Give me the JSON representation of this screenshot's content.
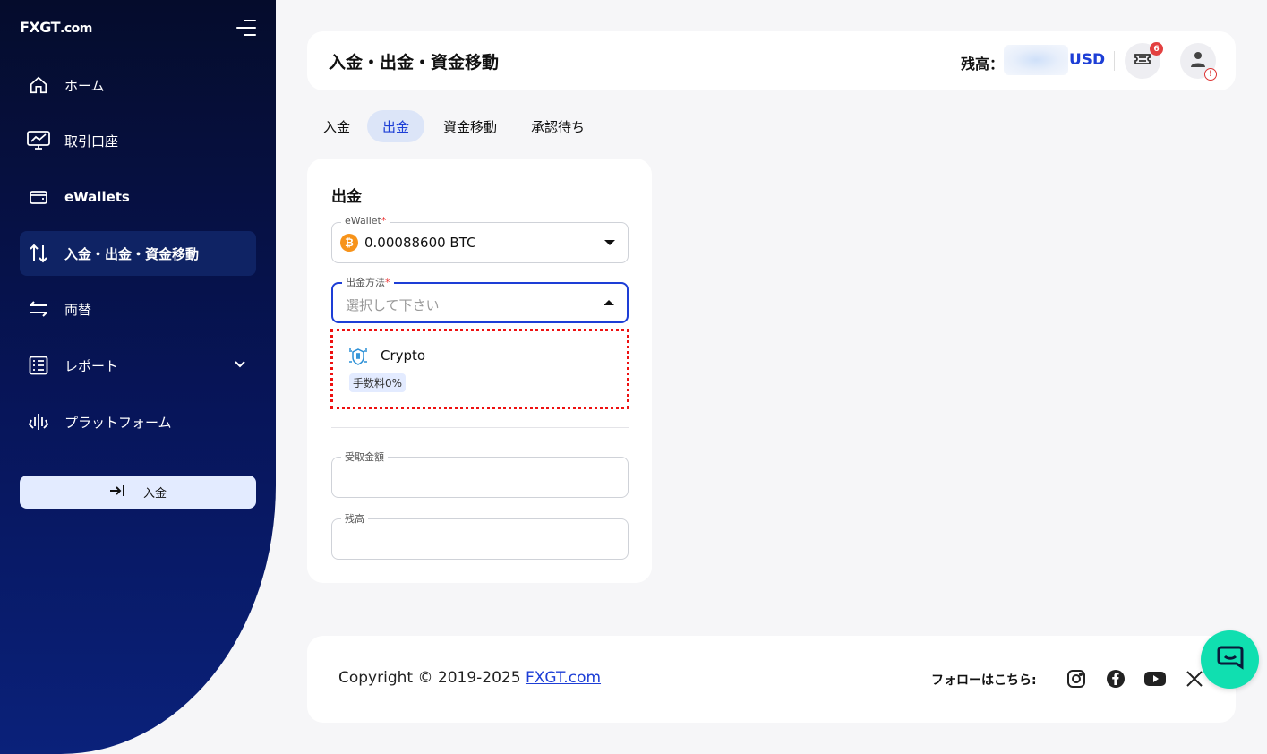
{
  "sidebar": {
    "logo_fx": "FX",
    "logo_gt": "GT",
    "logo_domain": ".com",
    "items": [
      {
        "label": "ホーム"
      },
      {
        "label": "取引口座"
      },
      {
        "label": "eWallets"
      },
      {
        "label": "入金・出金・資金移動"
      },
      {
        "label": "両替"
      },
      {
        "label": "レポート"
      },
      {
        "label": "プラットフォーム"
      }
    ],
    "deposit_button": "入金"
  },
  "header": {
    "title": "入金・出金・資金移動",
    "balance_label": "残高：",
    "currency": "USD",
    "notification_count": "6",
    "alert_mark": "!"
  },
  "tabs": [
    {
      "label": "入金"
    },
    {
      "label": "出金"
    },
    {
      "label": "資金移動"
    },
    {
      "label": "承認待ち"
    }
  ],
  "form": {
    "title": "出金",
    "ewallet_label": "eWallet",
    "required_mark": "*",
    "ewallet_value": "0.00088600 BTC",
    "btc_symbol": "₿",
    "method_label": "出金方法",
    "method_placeholder": "選択して下さい",
    "option_name": "Crypto",
    "option_fee": "手数料0%",
    "receive_label": "受取金額",
    "balance_label": "残高"
  },
  "footer": {
    "copyright_prefix": "Copyright © 2019-2025 ",
    "copyright_link": "FXGT.com",
    "follow_label": "フォローはこちら:"
  },
  "colors": {
    "accent": "#1d3ed6",
    "sidebar_bg": "#07155a",
    "chat": "#10dfb0",
    "highlight_border": "#ee1111"
  }
}
